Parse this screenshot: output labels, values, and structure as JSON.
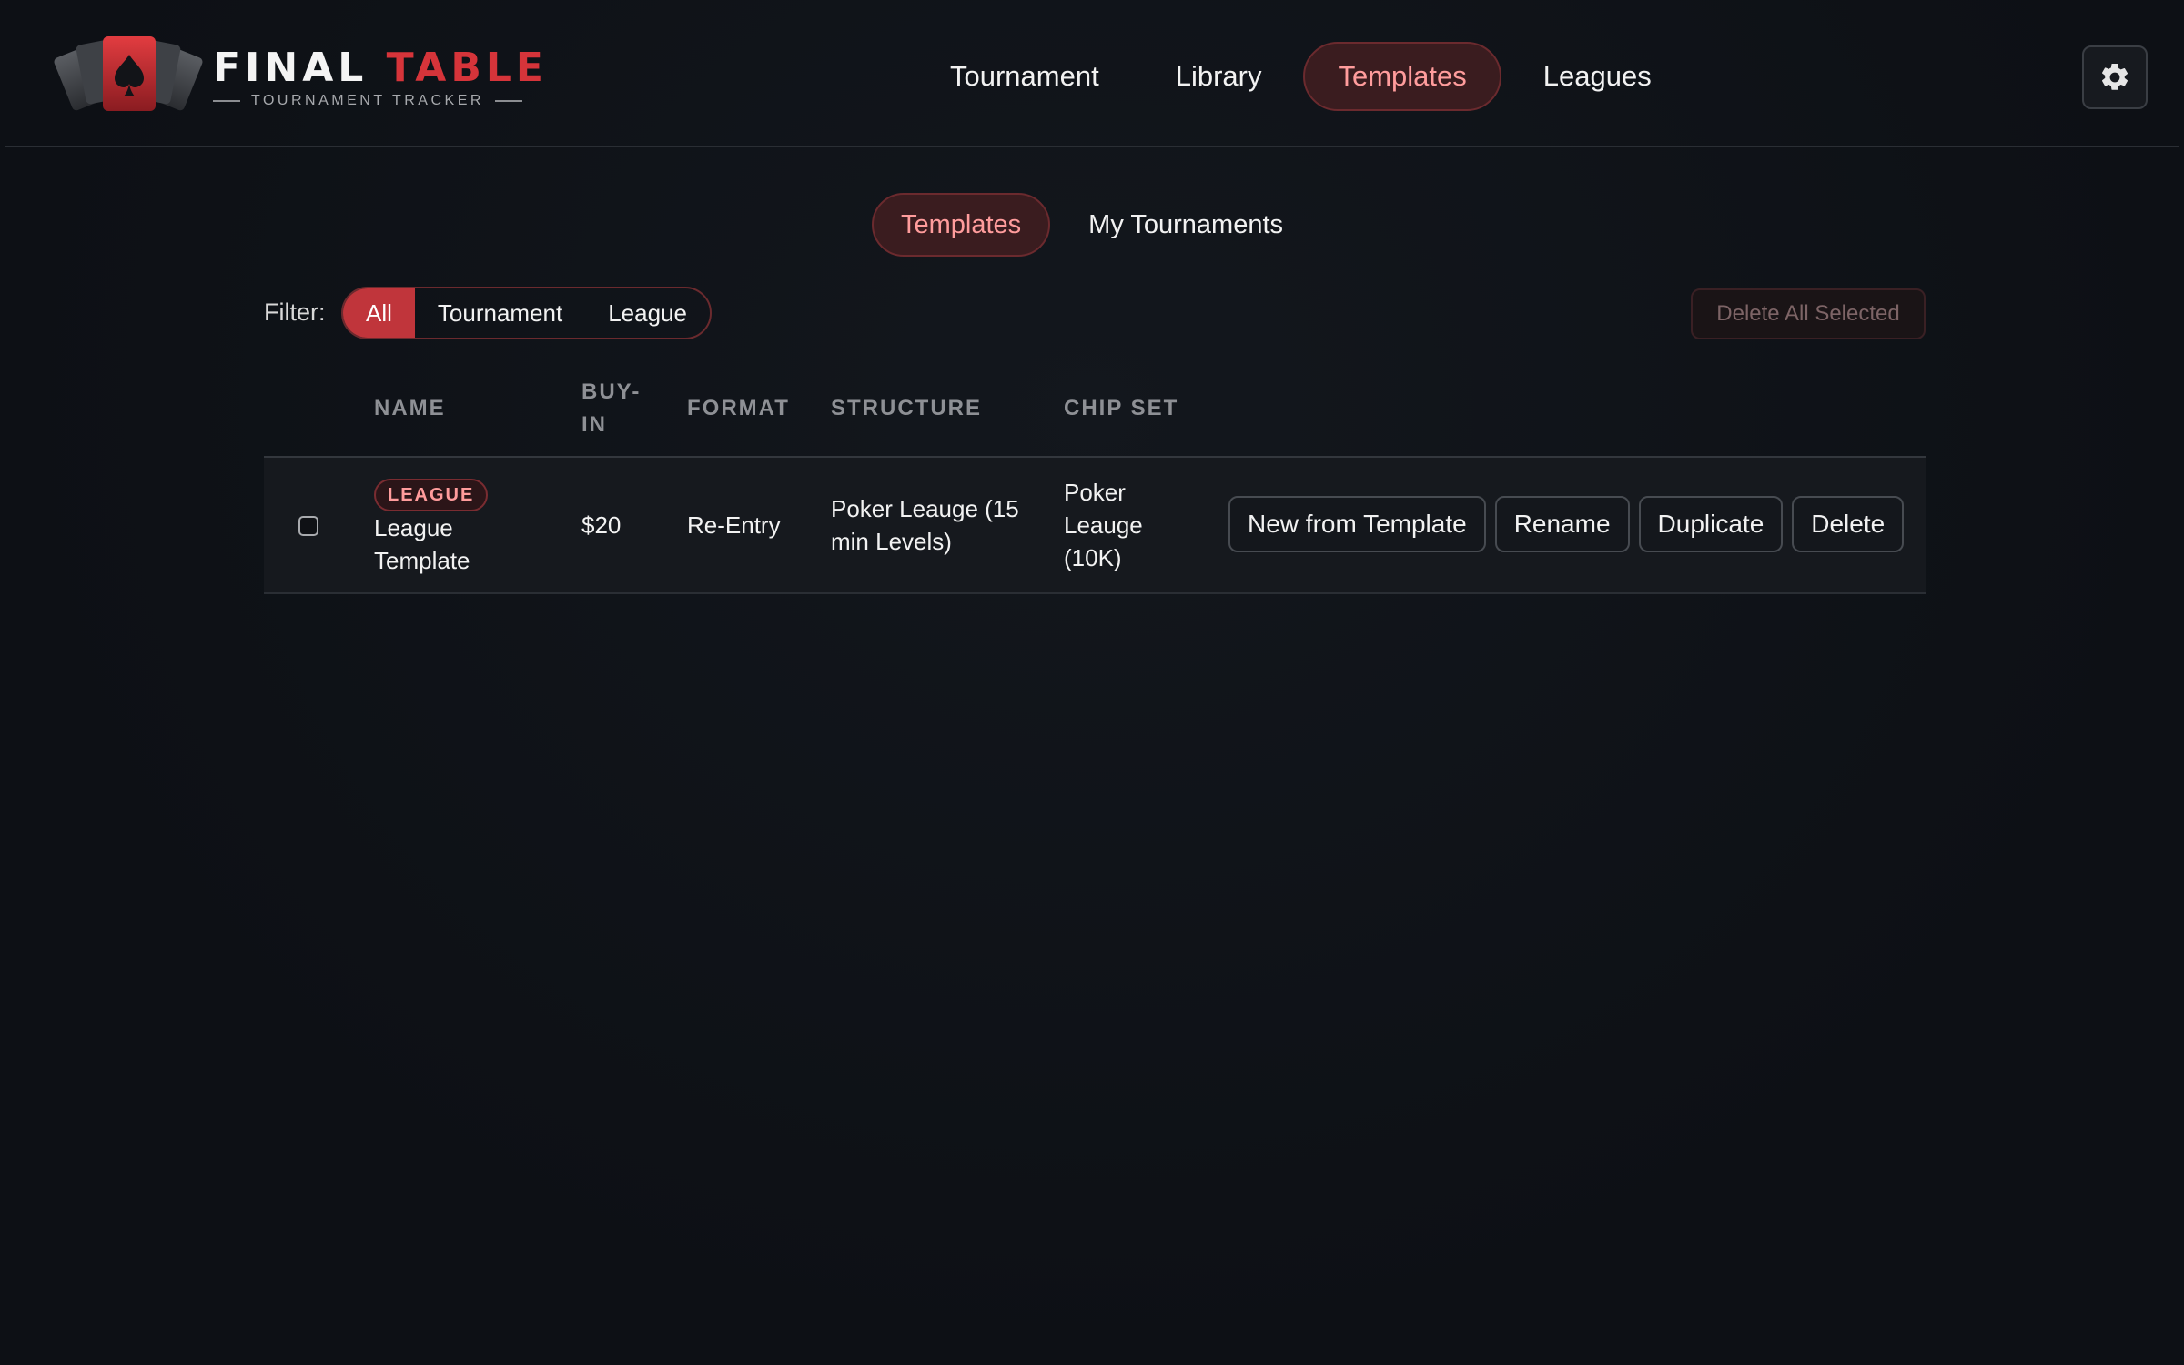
{
  "app": {
    "title_word1": "FINAL",
    "title_word2": "TABLE",
    "subtitle": "TOURNAMENT TRACKER"
  },
  "nav": {
    "items": [
      {
        "label": "Tournament"
      },
      {
        "label": "Library"
      },
      {
        "label": "Templates",
        "active": true
      },
      {
        "label": "Leagues"
      }
    ]
  },
  "subtabs": [
    {
      "label": "Templates",
      "active": true
    },
    {
      "label": "My Tournaments"
    }
  ],
  "filter": {
    "label": "Filter:",
    "options": [
      {
        "label": "All",
        "active": true
      },
      {
        "label": "Tournament"
      },
      {
        "label": "League"
      }
    ]
  },
  "toolbar": {
    "delete_all_label": "Delete All Selected"
  },
  "table": {
    "headers": {
      "name": "NAME",
      "buyin_line1": "BUY-",
      "buyin_line2": "IN",
      "format": "FORMAT",
      "structure": "STRUCTURE",
      "chipset": "CHIP SET"
    },
    "rows": [
      {
        "badge": "LEAGUE",
        "name_line1": "League",
        "name_line2": "Template",
        "buyin": "$20",
        "format": "Re-Entry",
        "structure_line1": "Poker Leauge (15",
        "structure_line2": "min Levels)",
        "chipset_line1": "Poker",
        "chipset_line2": "Leauge",
        "chipset_line3": "(10K)",
        "checked": false
      }
    ],
    "row_actions": {
      "new_from_template": "New from Template",
      "rename": "Rename",
      "duplicate": "Duplicate",
      "delete": "Delete"
    }
  },
  "icons": {
    "settings": "gear-icon",
    "logo": "spade-card-icon"
  },
  "colors": {
    "accent": "#c0353b",
    "accent_text": "#ff9c9c",
    "background": "#0e1116"
  }
}
